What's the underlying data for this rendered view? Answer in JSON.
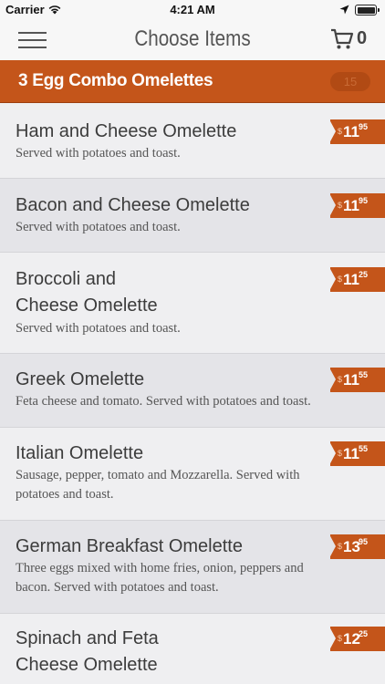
{
  "status": {
    "carrier": "Carrier",
    "time": "4:21 AM"
  },
  "nav": {
    "title": "Choose Items",
    "cart_count": "0"
  },
  "category": {
    "title": "3 Egg Combo Omelettes",
    "count": "15"
  },
  "items": [
    {
      "name_lines": [
        "Ham and Cheese Omelette"
      ],
      "desc": "Served with potatoes and toast.",
      "price_dollar": "$",
      "price_main": "11",
      "price_cents": "95",
      "price": 11.95
    },
    {
      "name_lines": [
        "Bacon and Cheese Omelette"
      ],
      "desc": "Served with potatoes and toast.",
      "price_dollar": "$",
      "price_main": "11",
      "price_cents": "95",
      "price": 11.95
    },
    {
      "name_lines": [
        "Broccoli and",
        "Cheese Omelette"
      ],
      "desc": "Served with potatoes and toast.",
      "price_dollar": "$",
      "price_main": "11",
      "price_cents": "25",
      "price": 11.25
    },
    {
      "name_lines": [
        "Greek Omelette"
      ],
      "desc": "Feta cheese and tomato. Served with potatoes and toast.",
      "price_dollar": "$",
      "price_main": "11",
      "price_cents": "55",
      "price": 11.55
    },
    {
      "name_lines": [
        "Italian Omelette"
      ],
      "desc": "Sausage, pepper, tomato and Mozzarella. Served with potatoes and toast.",
      "price_dollar": "$",
      "price_main": "11",
      "price_cents": "55",
      "price": 11.55
    },
    {
      "name_lines": [
        "German Breakfast Omelette"
      ],
      "desc": "Three eggs mixed with home fries, onion, peppers and bacon. Served with potatoes and toast.",
      "price_dollar": "$",
      "price_main": "13",
      "price_cents": "95",
      "price": 13.95
    },
    {
      "name_lines": [
        "Spinach and Feta",
        "Cheese Omelette"
      ],
      "desc": "",
      "price_dollar": "$",
      "price_main": "12",
      "price_cents": "25",
      "price": 12.25
    }
  ],
  "colors": {
    "accent": "#c4551a",
    "background": "#efeff1",
    "alt_row": "#e4e4e8"
  }
}
